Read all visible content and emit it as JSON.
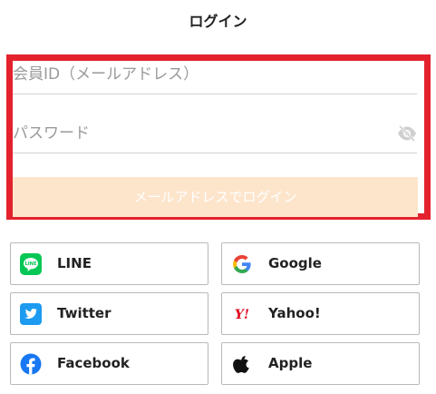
{
  "header": {
    "title": "ログイン"
  },
  "form": {
    "id_placeholder": "会員ID（メールアドレス）",
    "password_placeholder": "パスワード",
    "submit_label": "メールアドレスでログイン"
  },
  "social": {
    "line": {
      "label": "LINE",
      "icon": "line-icon"
    },
    "google": {
      "label": "Google",
      "icon": "google-icon"
    },
    "twitter": {
      "label": "Twitter",
      "icon": "twitter-icon"
    },
    "yahoo": {
      "label": "Yahoo!",
      "icon": "yahoo-icon",
      "icon_text": "Y!"
    },
    "facebook": {
      "label": "Facebook",
      "icon": "facebook-icon"
    },
    "apple": {
      "label": "Apple",
      "icon": "apple-icon"
    }
  },
  "colors": {
    "highlight": "#e3222d",
    "submit_bg": "#fde5cc",
    "line": "#06c755",
    "twitter": "#1d9bf0",
    "facebook": "#1877f2",
    "yahoo": "#e0001b"
  }
}
